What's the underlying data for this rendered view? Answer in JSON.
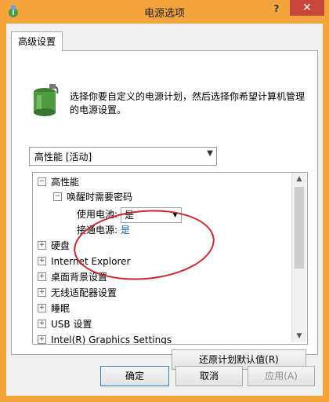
{
  "window": {
    "title": "电源选项",
    "help_label": "?",
    "close_label": "✕"
  },
  "tabs": [
    {
      "label": "高级设置"
    }
  ],
  "description": "选择你要自定义的电源计划，然后选择你希望计算机管理的电源设置。",
  "plan_select": {
    "value": "高性能 [活动]"
  },
  "tree": {
    "root": {
      "label": "高性能",
      "toggle": "−"
    },
    "wake_password": {
      "label": "唤醒时需要密码",
      "toggle": "−"
    },
    "on_battery": {
      "label": "使用电池:",
      "value": "是"
    },
    "plugged_in": {
      "label": "接通电源:",
      "value": "是"
    },
    "items": [
      {
        "label": "硬盘",
        "toggle": "+"
      },
      {
        "label": "Internet Explorer",
        "toggle": "+"
      },
      {
        "label": "桌面背景设置",
        "toggle": "+"
      },
      {
        "label": "无线适配器设置",
        "toggle": "+"
      },
      {
        "label": "睡眠",
        "toggle": "+"
      },
      {
        "label": "USB 设置",
        "toggle": "+"
      },
      {
        "label": "Intel(R) Graphics Settings",
        "toggle": "+"
      }
    ]
  },
  "buttons": {
    "restore": "还原计划默认值(R)",
    "ok": "确定",
    "cancel": "取消",
    "apply": "应用(A)"
  },
  "colors": {
    "frame": "#f3a43c",
    "close": "#c7473a",
    "highlight_circle": "#c8282f",
    "value_text": "#1a5aa8"
  }
}
